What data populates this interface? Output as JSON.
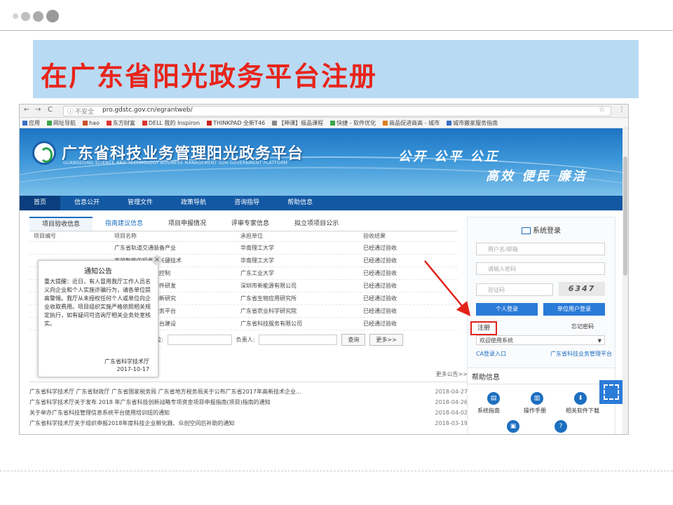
{
  "slide": {
    "title": "在广东省阳光政务平台注册"
  },
  "browser": {
    "url_prefix": "不安全",
    "url": "pro.gdstc.gov.cn/egrantweb/",
    "bookmarks": [
      "应用",
      "网址导航",
      "hao",
      "东方财富",
      "DELL 我的 Inspiron",
      "THINKPAD 全新T46",
      "【神课】极品课程",
      "快捷 - 软件优化",
      "商品促进商高 - 城市",
      "城市搬家服务指南"
    ]
  },
  "site": {
    "name": "广东省科技业务管理阳光政务平台",
    "name_en": "GUANGDONG SCIENCE AND TECHNOLOGY BUSINESS MANAGEMENT SUN GOVERNMENT PLATFORM",
    "slogan1": "公开  公平  公正",
    "slogan2": "高效  便民  廉洁"
  },
  "nav": [
    "首页",
    "信息公开",
    "管理文件",
    "政策导航",
    "咨询指导",
    "帮助信息"
  ],
  "tabs": [
    "项目验收信息",
    "指南建议信息",
    "项目申报情况",
    "评审专家信息",
    "拟立项项目公示"
  ],
  "table": {
    "headers": [
      "项目编号",
      "项目名称",
      "承担单位",
      "验收结果"
    ],
    "rows": [
      [
        "",
        "广东省轨道交通装备产业",
        "华南理工大学",
        "已经通过验收"
      ],
      [
        "",
        "高效智能的机器人关键技术",
        "华南理工大学",
        "已经通过验收"
      ],
      [
        "",
        "嵌入式系统的智能控制",
        "广东工业大学",
        "已经通过验收"
      ],
      [
        "",
        "新能源汽车关键部件研发",
        "深圳市新能源有限公司",
        "已经通过验收"
      ],
      [
        "",
        "产业化转化工艺创新研究",
        "广东省生物应用研究所",
        "已经通过验收"
      ],
      [
        "",
        "广东省产业创新服务平台",
        "广东省农业科学研究院",
        "已经通过验收"
      ],
      [
        "",
        "数字化科技服务平台建设",
        "广东省科技服务有限公司",
        "已经通过验收"
      ]
    ],
    "search": {
      "unit_label": "承担单位:",
      "person_label": "负责人:",
      "query": "查询",
      "more": "更多>>"
    }
  },
  "popup": {
    "title": "通知公告",
    "body": "重大提醒：近日，有人冒用我厅工作人员名义向企业和个人实施诈骗行为，请各单位提高警惕。我厅从未授权任何个人或单位向企业收取费用。项目组织实施严格依照相关规定执行，如有疑问可咨询厅相关业务处室核实。",
    "sign_org": "广东省科学技术厅",
    "sign_date": "2017-10-17"
  },
  "news": {
    "head": "通知公告",
    "more": "更多公告>>",
    "items": [
      {
        "title": "广东省科学技术厅 广东省财政厅 广东省国家税务局 广东省地方税务局关于公布广东省2017年高新技术企业...",
        "date": "2018-04-27"
      },
      {
        "title": "广东省科学技术厅关于发布 2018 年广东省科技创新战略专项资金项目申报指南(项目)指南的通知",
        "date": "2018-04-26"
      },
      {
        "title": "关于举办广东省科技管理信息系统平台使用培训班的通知",
        "date": "2018-04-02"
      },
      {
        "title": "广东省科学技术厅关于组织申报2018年度科技企业孵化器、众创空间后补助的通知",
        "date": "2018-03-19"
      }
    ]
  },
  "login": {
    "title": "系统登录",
    "username_placeholder": "用户名/邮箱",
    "password_placeholder": "请输入密码",
    "captcha_placeholder": "验证码",
    "captcha_text": "6347",
    "login_btn": "个人登录",
    "unit_login_btn": "单位用户登录",
    "register": "注册",
    "forgot": "忘记密码",
    "system_select": "欢迎使用系统",
    "ca_link": "CA登录入口",
    "platform_link": "广东省科技业务管理平台"
  },
  "help": {
    "title": "帮助信息",
    "items": [
      "系统指南",
      "操作手册",
      "相关软件下载"
    ]
  },
  "colors": {
    "title_red": "#e8241a",
    "title_band": "#b9daf3",
    "nav_blue": "#1358a3",
    "highlight_red": "#e3221b"
  }
}
